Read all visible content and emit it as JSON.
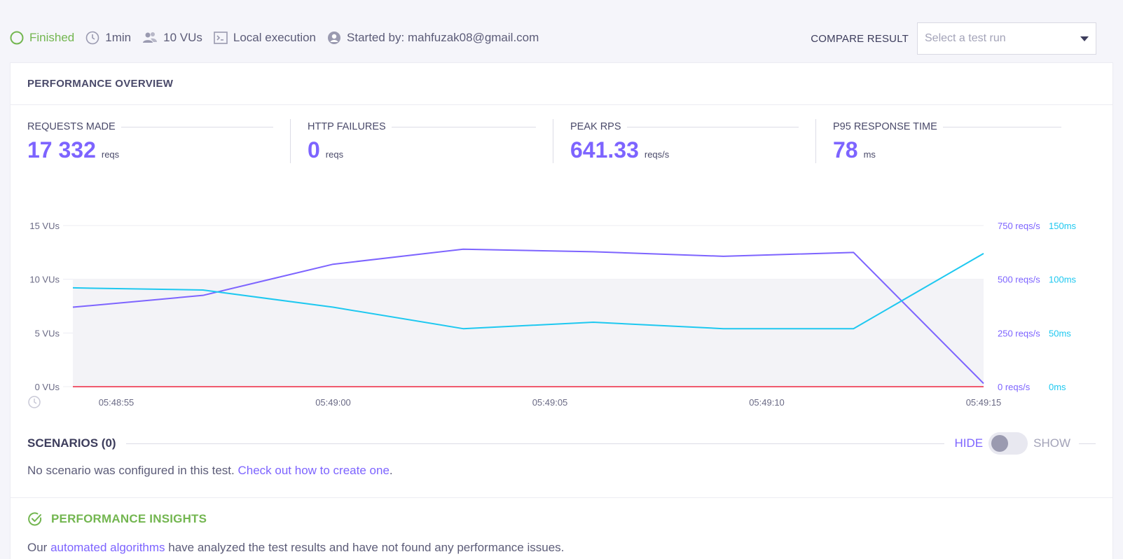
{
  "status": {
    "state": "Finished",
    "duration": "1min",
    "vus": "10 VUs",
    "execution": "Local execution",
    "started_by": "Started by: mahfuzak08@gmail.com"
  },
  "compare": {
    "label": "COMPARE RESULT",
    "placeholder": "Select a test run"
  },
  "overview": {
    "title": "PERFORMANCE OVERVIEW",
    "metrics": [
      {
        "label": "REQUESTS MADE",
        "value": "17 332",
        "unit": "reqs"
      },
      {
        "label": "HTTP FAILURES",
        "value": "0",
        "unit": "reqs"
      },
      {
        "label": "PEAK RPS",
        "value": "641.33",
        "unit": "reqs/s"
      },
      {
        "label": "P95 RESPONSE TIME",
        "value": "78",
        "unit": "ms"
      }
    ]
  },
  "colors": {
    "accent": "#7d64ff",
    "response_time": "#1ec8f0",
    "failures": "#f05a6e",
    "vus_area": "#f3f3f7",
    "success": "#73b650"
  },
  "chart_data": {
    "type": "line",
    "x": [
      "05:48:53",
      "05:48:56",
      "05:49:00",
      "05:49:03",
      "05:49:06",
      "05:49:09",
      "05:49:12",
      "05:49:15"
    ],
    "x_ticks": [
      "05:48:55",
      "05:49:00",
      "05:49:05",
      "05:49:10",
      "05:49:15"
    ],
    "y_left": {
      "ticks": [
        "0 VUs",
        "5 VUs",
        "10 VUs",
        "15 VUs"
      ],
      "range": [
        0,
        15
      ]
    },
    "y_right_rps": {
      "ticks": [
        "0 reqs/s",
        "250 reqs/s",
        "500 reqs/s",
        "750 reqs/s"
      ],
      "range": [
        0,
        750
      ]
    },
    "y_right_ms": {
      "ticks": [
        "0ms",
        "50ms",
        "100ms",
        "150ms"
      ],
      "range": [
        0,
        150
      ]
    },
    "series": [
      {
        "name": "VUs",
        "axis": "left",
        "values": [
          10,
          10,
          10,
          10,
          10,
          10,
          10,
          10
        ]
      },
      {
        "axis": "rps",
        "values": [
          370,
          425,
          570,
          640,
          628,
          607,
          625,
          15
        ]
      },
      {
        "axis": "ms",
        "values": [
          92,
          90,
          74,
          54,
          60,
          54,
          54,
          124
        ]
      },
      {
        "axis": "rps",
        "values": [
          0,
          0,
          0,
          0,
          0,
          0,
          0,
          0
        ]
      }
    ],
    "grid": true
  },
  "scenarios": {
    "title": "SCENARIOS (0)",
    "hide_label": "HIDE",
    "show_label": "SHOW",
    "text": "No scenario was configured in this test. ",
    "link": "Check out how to create one",
    "link_suffix": "."
  },
  "insights": {
    "title": "PERFORMANCE INSIGHTS",
    "text_prefix": "Our ",
    "link": "automated algorithms",
    "text_suffix": " have analyzed the test results and have not found any performance issues."
  }
}
